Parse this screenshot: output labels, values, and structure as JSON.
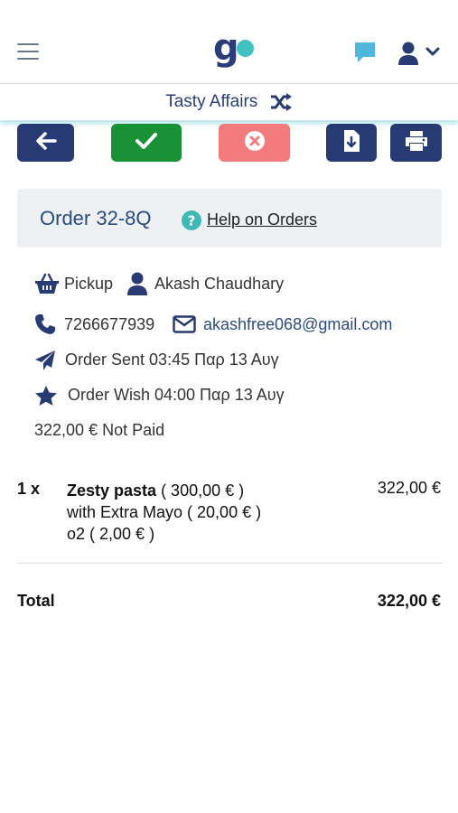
{
  "header": {
    "menu_icon": "hamburger-menu-icon",
    "logo_text": "g",
    "chat_icon": "chat-bubble-icon",
    "user_icon": "user-icon",
    "colors": {
      "logo_dark": "#2a3d7a",
      "logo_dot": "#3fc1c0",
      "chat": "#4fb6dd"
    }
  },
  "store": {
    "name": "Tasty Affairs",
    "switch_icon": "shuffle-icon"
  },
  "actions": {
    "back_icon": "arrow-left-icon",
    "accept_icon": "check-icon",
    "reject_icon": "close-circle-icon",
    "download_icon": "file-download-icon",
    "print_icon": "printer-icon",
    "colors": {
      "navy": "#283a73",
      "green": "#199137",
      "red": "#f47b7b"
    }
  },
  "order": {
    "title": "Order 32-8Q",
    "help_link": "Help on Orders",
    "type": "Pickup",
    "customer": "Akash Chaudhary",
    "phone": "7266677939",
    "email": "akashfree068@gmail.com",
    "sent": "Order Sent 03:45 Παρ 13 Αυγ",
    "wish": "Order Wish 04:00 Παρ 13 Αυγ",
    "payment": "322,00 € Not Paid"
  },
  "items": [
    {
      "qty": "1 x",
      "name": "Zesty pasta",
      "price": "( 300,00 € )",
      "extra1": "with Extra Mayo ( 20,00 € )",
      "extra2": "o2 ( 2,00 € )",
      "total": "322,00 €"
    }
  ],
  "summary": {
    "total_label": "Total",
    "total_value": "322,00 €"
  }
}
